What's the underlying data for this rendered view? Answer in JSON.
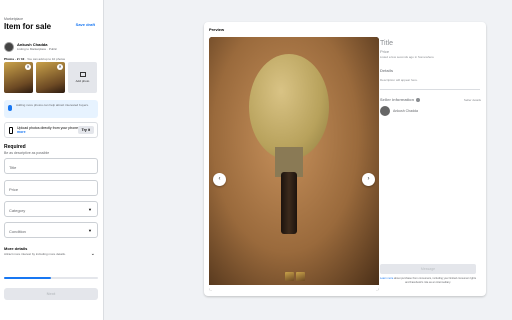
{
  "sidebar": {
    "breadcrumb": "Marketplace",
    "title": "Item for sale",
    "save_draft": "Save draft",
    "user": {
      "name": "Ankush Chadda",
      "listing_info": "Listing to Marketplace · Public"
    },
    "photos_label": "Photos · 2 / 10",
    "photos_hint": " · You can add up to 10 photos",
    "add_photo": "Add photo",
    "tip": "Adding more photos can help attract interested buyers.",
    "upload": {
      "text": "Upload photos directly from your phone.",
      "link": "Learn more",
      "button": "Try it"
    },
    "required": "Required",
    "required_sub": "Be as descriptive as possible",
    "fields": {
      "title": "Title",
      "price": "Price",
      "category": "Category",
      "condition": "Condition"
    },
    "more_details": "More details",
    "more_details_sub": "Attract more interest by including more details.",
    "progress": 0.5,
    "next": "Next"
  },
  "preview": {
    "label": "Preview",
    "title": "Title",
    "price": "Price",
    "listed": "Listed a few seconds ago in Somewhere",
    "details": "Details",
    "description": "Description will appear here.",
    "seller_info": "Seller information",
    "seller_details": "Seller details",
    "seller_name": "Ankush Chadda",
    "message": "Message",
    "disclaimer_link": "Learn more",
    "disclaimer": " about purchase from consumers, including your limited consumer rights and Facebook's role as an intermediary."
  }
}
